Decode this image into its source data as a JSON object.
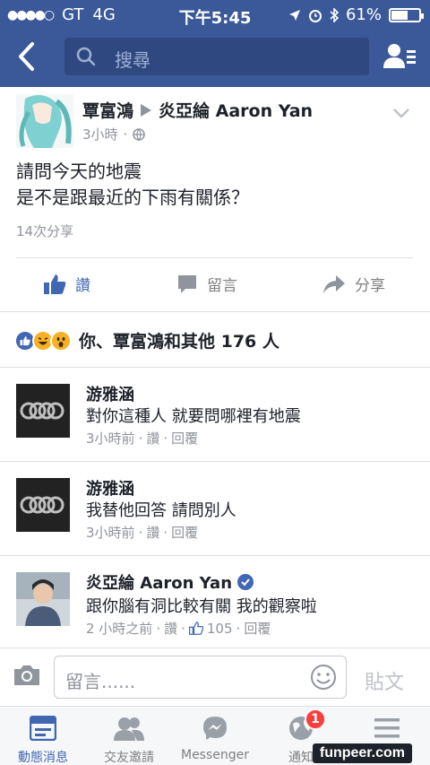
{
  "status_bar": {
    "carrier": "GT",
    "network": "4G",
    "time": "下午5:45",
    "battery_percent": "61%",
    "battery_level": 0.61
  },
  "nav": {
    "search_placeholder": "搜尋"
  },
  "post": {
    "author": "覃富鴻",
    "recipient": "炎亞綸 Aaron Yan",
    "time": "3小時",
    "text_line1": "請問今天的地震",
    "text_line2": "是不是跟最近的下雨有關係？",
    "shares": "14次分享",
    "actions": {
      "like": "讚",
      "comment": "留言",
      "share": "分享"
    },
    "reactions_summary": "你、覃富鴻和其他 176 人"
  },
  "comments": [
    {
      "name": "游雅涵",
      "text": "對你這種人 就要問哪裡有地震",
      "time": "3小時前",
      "like": "讚",
      "reply": "回覆"
    },
    {
      "name": "游雅涵",
      "text": "我替他回答 請問別人",
      "time": "3小時前",
      "like": "讚",
      "reply": "回覆"
    },
    {
      "name": "炎亞綸 Aaron Yan",
      "text": "跟你腦有洞比較有關 我的觀察啦",
      "time": "2 小時之前",
      "like": "讚",
      "like_count": "105",
      "reply": "回覆"
    }
  ],
  "composer": {
    "placeholder": "留言......",
    "post_label": "貼文"
  },
  "tabs": [
    {
      "label": "動態消息"
    },
    {
      "label": "交友邀請"
    },
    {
      "label": "Messenger"
    },
    {
      "label": "通知",
      "badge": "1"
    },
    {
      "label": "更多"
    }
  ],
  "watermark": "funpeer.com",
  "colors": {
    "brand": "#3b5998",
    "link_blue": "#4267b2",
    "secondary_text": "#90949c",
    "badge_red": "#fa3e3e"
  }
}
